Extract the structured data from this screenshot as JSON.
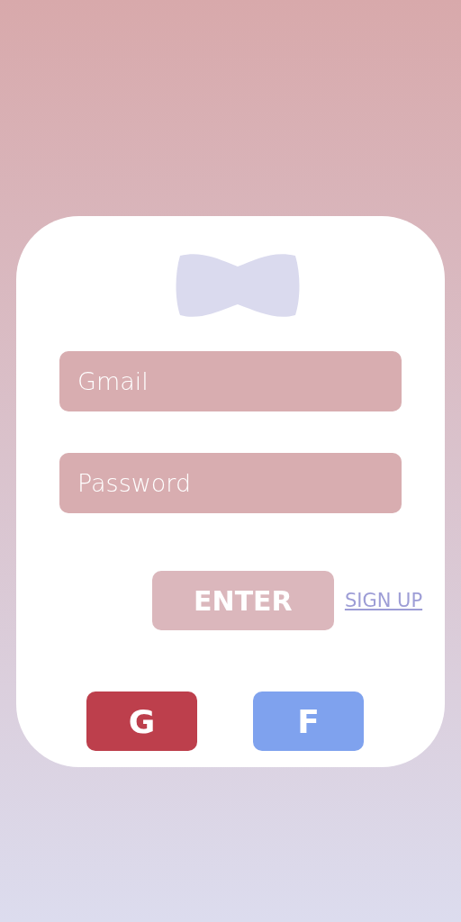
{
  "login": {
    "fields": [
      {
        "placeholder": "Gmail"
      },
      {
        "placeholder": "Password"
      }
    ],
    "enter_button": "ENTER",
    "signup_link": "SIGN UP",
    "social_buttons": [
      {
        "label": "G",
        "color": "#bd3f4c"
      },
      {
        "label": "F",
        "color": "#7fa2ee"
      }
    ]
  }
}
